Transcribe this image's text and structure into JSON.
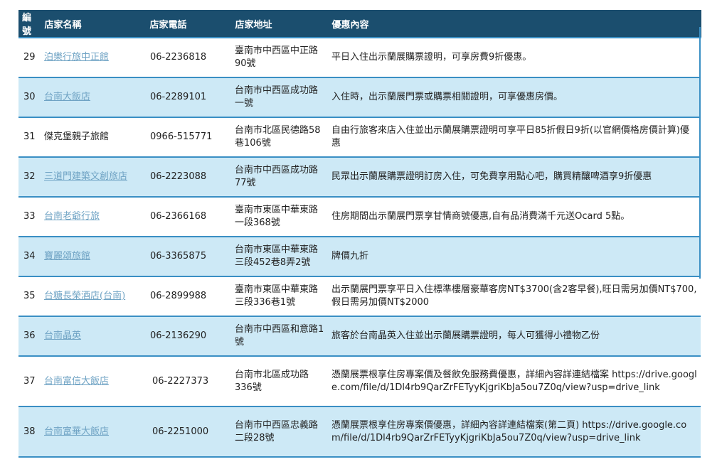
{
  "headers": {
    "num": "編號",
    "name": "店家名稱",
    "phone": "店家電話",
    "address": "店家地址",
    "offer": "優惠內容"
  },
  "rows": [
    {
      "num": "29",
      "name": "泊樂行旅中正館",
      "linked": true,
      "phone": "06-2236818",
      "address": "臺南市中西區中正路90號",
      "offer": "平日入住出示蘭展購票證明，可享房費9折優惠。"
    },
    {
      "num": "30",
      "name": "台南大飯店",
      "linked": true,
      "phone": "06-2289101",
      "address": "台南市中西區成功路一號",
      "offer": "入住時，出示蘭展門票或購票相關證明，可享優惠房價。"
    },
    {
      "num": "31",
      "name": "傑克堡親子旅館",
      "linked": false,
      "phone": "0966-515771",
      "address": "台南市北區民德路58巷106號",
      "offer": "自由行旅客來店入住並出示蘭展購票證明可享平日85折假日9折(以官網價格房價計算)優惠"
    },
    {
      "num": "32",
      "name": "三道門建築文創旅店",
      "linked": true,
      "phone": "06-2223088",
      "address": "台南市中西區成功路77號",
      "offer": "民眾出示蘭展購票證明訂房入住，可免費享用點心吧，購買精釀啤酒享9折優惠"
    },
    {
      "num": "33",
      "name": "台南老爺行旅",
      "linked": true,
      "phone": "06-2366168",
      "address": "臺南市東區中華東路一段368號",
      "offer": "住房期間出示蘭展門票享甘情商號優惠,自有品消費滿千元送Ocard 5點。"
    },
    {
      "num": "34",
      "name": "寶麗頌旅館",
      "linked": true,
      "phone": "06-3365875",
      "address": "台南市東區中華東路三段452巷8弄2號",
      "offer": "牌價九折"
    },
    {
      "num": "35",
      "name": "台糖長榮酒店(台南)",
      "linked": true,
      "phone": "06-2899988",
      "address": "臺南市東區中華東路三段336巷1號",
      "offer": "出示蘭展門票享平日入住標準樓層豪華客房NT$3700(含2客早餐),旺日需另加價NT$700,假日需另加價NT$2000"
    },
    {
      "num": "36",
      "name": "台南晶英",
      "linked": true,
      "phone": "06-2136290",
      "address": "台南市中西區和意路1號",
      "offer": "旅客於台南晶英入住並出示蘭展購票證明，每人可獲得小禮物乙份"
    },
    {
      "num": "37",
      "name": "台南富信大飯店",
      "linked": true,
      "phone": "06-2227373",
      "address": "台南市北區成功路336號",
      "offer": "憑蘭展票根享住房專案價及餐飲免服務費優惠，詳細內容詳連結檔案 https://drive.google.com/file/d/1Dl4rb9QarZrFETyyKjgriKbJa5ou7Z0q/view?usp=drive_link"
    },
    {
      "num": "38",
      "name": "台南富華大飯店",
      "linked": true,
      "phone": "06-2251000",
      "address": "台南市中西區忠義路二段28號",
      "offer": "憑蘭展票根享住房專案價優惠，詳細內容詳連結檔案(第二頁) https://drive.google.com/file/d/1Dl4rb9QarZrFETyyKjgriKbJa5ou7Z0q/view?usp=drive_link"
    }
  ]
}
